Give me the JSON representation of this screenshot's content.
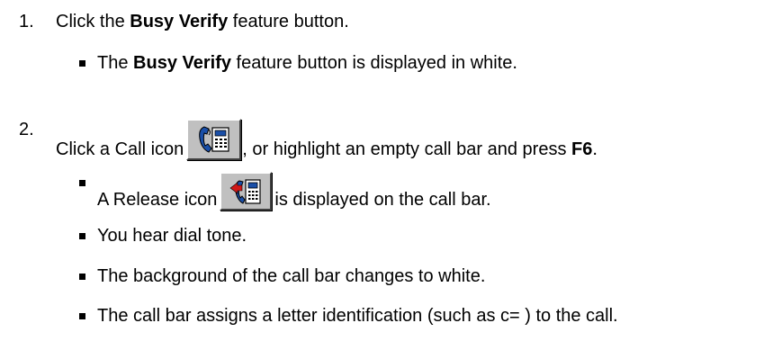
{
  "steps": [
    {
      "number": "1.",
      "text_before": "Click the ",
      "bold": "Busy Verify",
      "text_after": " feature button."
    },
    {
      "number": "2.",
      "text_before": "Click a Call icon",
      "text_middle": ", or highlight an empty call bar and press ",
      "bold": "F6",
      "text_after": "."
    }
  ],
  "step1_bullets": [
    {
      "text_before": "The ",
      "bold": "Busy Verify",
      "text_after": " feature button is displayed in white."
    }
  ],
  "step2_bullets": [
    {
      "text_before": "A Release icon",
      "text_after": "is displayed on the call bar."
    },
    {
      "text": "You hear dial tone."
    },
    {
      "text": "The background of the call bar changes to white."
    },
    {
      "text": "The call bar assigns a letter identification (such as c= ) to the call."
    }
  ],
  "icons": {
    "call_icon": "call-icon",
    "release_icon": "release-icon"
  }
}
